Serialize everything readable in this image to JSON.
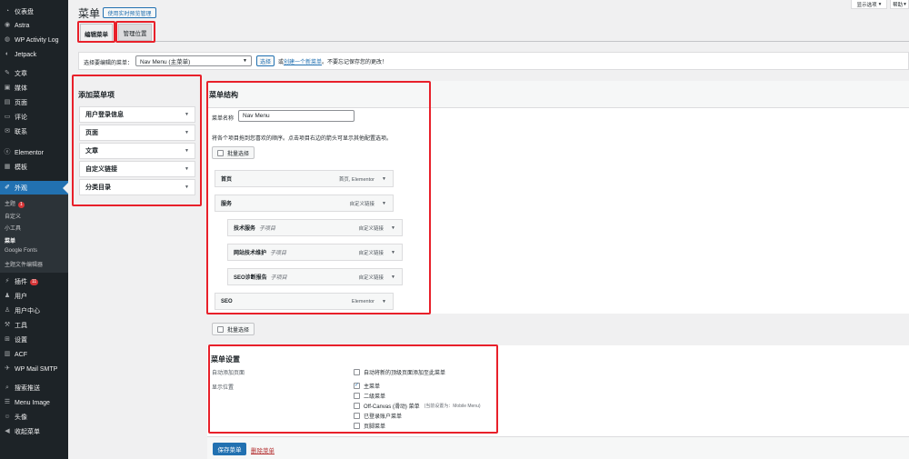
{
  "sidebar": {
    "items": [
      {
        "label": "仪表盘",
        "icon": "dashboard-icon"
      },
      {
        "label": "Astra",
        "icon": "astra-icon"
      },
      {
        "label": "WP Activity Log",
        "icon": "activity-log-icon"
      },
      {
        "label": "Jetpack",
        "icon": "jetpack-icon"
      },
      {
        "label": "文章",
        "icon": "pin-icon"
      },
      {
        "label": "媒体",
        "icon": "media-icon"
      },
      {
        "label": "页面",
        "icon": "page-icon"
      },
      {
        "label": "评论",
        "icon": "comment-icon"
      },
      {
        "label": "联系",
        "icon": "mail-icon"
      },
      {
        "label": "Elementor",
        "icon": "elementor-icon"
      },
      {
        "label": "模板",
        "icon": "template-icon"
      },
      {
        "label": "外观",
        "icon": "brush-icon"
      },
      {
        "label": "插件",
        "icon": "plugin-icon",
        "badge": "11"
      },
      {
        "label": "用户",
        "icon": "user-icon"
      },
      {
        "label": "用户中心",
        "icon": "user-center-icon"
      },
      {
        "label": "工具",
        "icon": "wrench-icon"
      },
      {
        "label": "设置",
        "icon": "settings-icon"
      },
      {
        "label": "ACF",
        "icon": "acf-icon"
      },
      {
        "label": "WP Mail SMTP",
        "icon": "smtp-icon"
      },
      {
        "label": "搜索推送",
        "icon": "search-push-icon"
      },
      {
        "label": "Menu Image",
        "icon": "menu-image-icon"
      },
      {
        "label": "头像",
        "icon": "avatar-icon"
      },
      {
        "label": "收起菜单",
        "icon": "collapse-icon"
      }
    ],
    "submenu": [
      {
        "label": "主题",
        "badge": "1"
      },
      {
        "label": "自定义"
      },
      {
        "label": "小工具"
      },
      {
        "label": "菜单"
      },
      {
        "label": "Google Fonts"
      },
      {
        "label": "主题文件编辑器"
      }
    ]
  },
  "header": {
    "title": "菜单",
    "live_preview_button": "使用实时预览管理",
    "screen_options": "显示选项",
    "screen_options_arrow": "▾",
    "help": "帮助",
    "help_arrow": "▾"
  },
  "tabs": {
    "edit": "编辑菜单",
    "locations": "管理位置"
  },
  "select_bar": {
    "label": "选择要编辑的菜单：",
    "selected": "Nav Menu (主菜单)",
    "select_button": "选择",
    "or": "或",
    "create_link": "创建一个新菜单",
    "note": "。不要忘记保存您的更改！"
  },
  "add_items": {
    "title": "添加菜单项",
    "sections": [
      "用户登录信息",
      "页面",
      "文章",
      "自定义链接",
      "分类目录"
    ]
  },
  "structure": {
    "title": "菜单结构",
    "name_label": "菜单名称",
    "name_value": "Nav Menu",
    "instructions": "将各个项目拖到您喜欢的顺序。点击项目右边的箭头可显示其他配置选项。",
    "bulk_select": "批量选择",
    "items": [
      {
        "title": "首页",
        "type": "首页, Elementor",
        "sub": ""
      },
      {
        "title": "服务",
        "type": "自定义链接",
        "sub": ""
      },
      {
        "title": "技术服务",
        "type": "自定义链接",
        "sub": "子项目"
      },
      {
        "title": "网站技术维护",
        "type": "自定义链接",
        "sub": "子项目"
      },
      {
        "title": "SEO诊断报告",
        "type": "自定义链接",
        "sub": "子项目"
      },
      {
        "title": "SEO",
        "type": "Elementor",
        "sub": ""
      }
    ]
  },
  "settings": {
    "title": "菜单设置",
    "auto_add_label": "自动添加页面",
    "auto_add_option": "自动将新的顶级页面添加至此菜单",
    "location_label": "显示位置",
    "locations": [
      {
        "label": "主菜单",
        "checked": true,
        "note": ""
      },
      {
        "label": "二级菜单",
        "checked": false,
        "note": ""
      },
      {
        "label": "Off-Canvas (滑动) 菜单",
        "checked": false,
        "note": "(当前设置为：Mobile Menu)"
      },
      {
        "label": "已登录账户菜单",
        "checked": false,
        "note": ""
      },
      {
        "label": "页脚菜单",
        "checked": false,
        "note": ""
      }
    ]
  },
  "footer": {
    "save": "保存菜单",
    "delete": "删除菜单"
  },
  "colors": {
    "sidebar_bg": "#1d2327",
    "accent": "#2271b1",
    "highlight_red": "#e8202a",
    "delete_red": "#b32d2e"
  }
}
